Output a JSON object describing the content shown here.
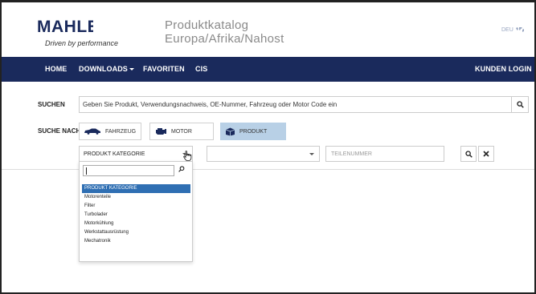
{
  "header": {
    "logo": "MAHLE",
    "tagline": "Driven by performance",
    "catalog_line1": "Produktkatalog",
    "catalog_line2": "Europa/Afrika/Nahost",
    "language": "DEU"
  },
  "nav": {
    "home": "HOME",
    "downloads": "DOWNLOADS",
    "favoriten": "FAVORITEN",
    "cis": "CIS",
    "kunden_login": "KUNDEN LOGIN"
  },
  "search": {
    "label": "SUCHEN",
    "placeholder": "Geben Sie Produkt, Verwendungsnachweis, OE-Nummer, Fahrzeug oder Motor Code ein"
  },
  "search_by": {
    "label": "SUCHE NACH",
    "fahrzeug": "FAHRZEUG",
    "motor": "MOTOR",
    "produkt": "PRODUKT",
    "active": "PRODUKT"
  },
  "filters": {
    "category_selected": "PRODUKT KATEGORIE",
    "second_selected": "",
    "teilenummer_placeholder": "TEILENUMMER"
  },
  "dropdown": {
    "options": [
      "PRODUKT KATEGORIE",
      "Motorenteile",
      "Filter",
      "Turbolader",
      "Motorkühlung",
      "Werkstattausrüstung",
      "Mechatronik"
    ],
    "selected_index": 0
  },
  "colors": {
    "nav_bg": "#1a2a5c",
    "brand": "#1a2a5c",
    "active_tab": "#b8d0e6",
    "option_selected": "#2f6fb3"
  }
}
